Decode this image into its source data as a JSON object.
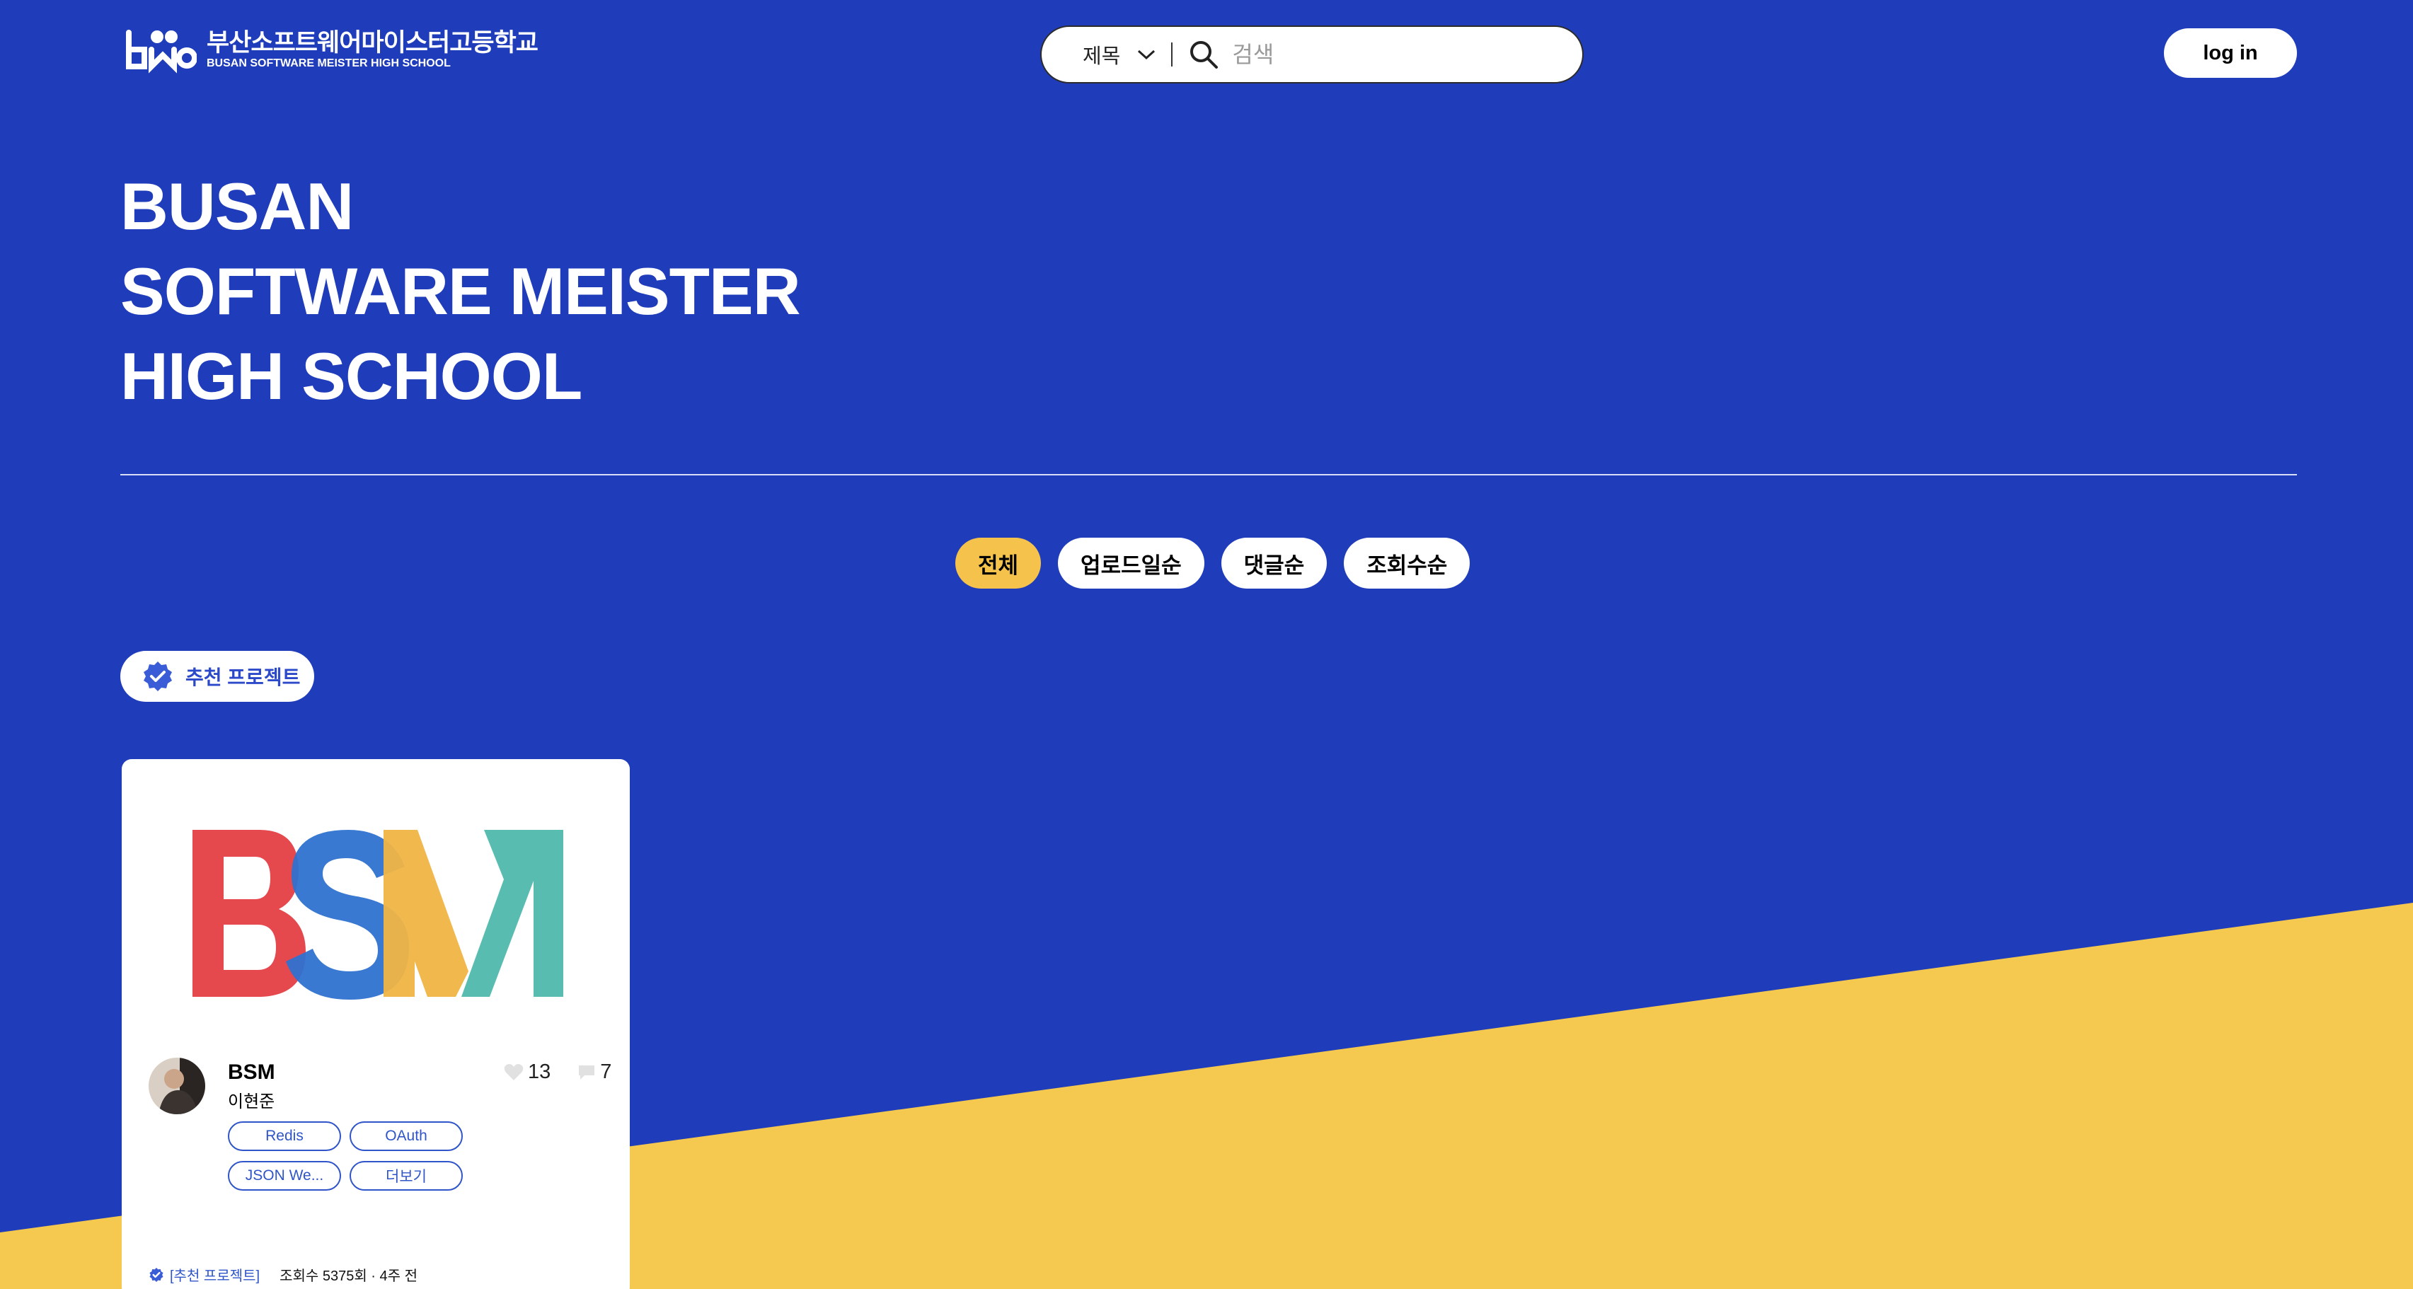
{
  "header": {
    "logo_ko": "부산소프트웨어마이스터고등학교",
    "logo_en": "BUSAN SOFTWARE MEISTER HIGH SCHOOL",
    "search": {
      "filter_selected": "제목",
      "placeholder": "검색",
      "value": ""
    },
    "login_label": "log in"
  },
  "hero": {
    "title_lines": [
      "BUSAN",
      "SOFTWARE MEISTER",
      "HIGH SCHOOL"
    ]
  },
  "sort_tabs": [
    {
      "label": "전체",
      "active": true
    },
    {
      "label": "업로드일순",
      "active": false
    },
    {
      "label": "댓글순",
      "active": false
    },
    {
      "label": "조회수순",
      "active": false
    }
  ],
  "recommended_badge": "추천 프로젝트",
  "projects": [
    {
      "thumbnail_text": "BSM",
      "title": "BSM",
      "author": "이현준",
      "likes": "13",
      "comments": "7",
      "tags": [
        "Redis",
        "OAuth",
        "JSON We...",
        "더보기"
      ],
      "footer_label": "[추천 프로젝트]",
      "footer_meta": "조회수 5375회 · 4주 전"
    }
  ],
  "colors": {
    "background": "#1f3cba",
    "accent_yellow": "#f5c24c",
    "tag_blue": "#2f55c9"
  }
}
